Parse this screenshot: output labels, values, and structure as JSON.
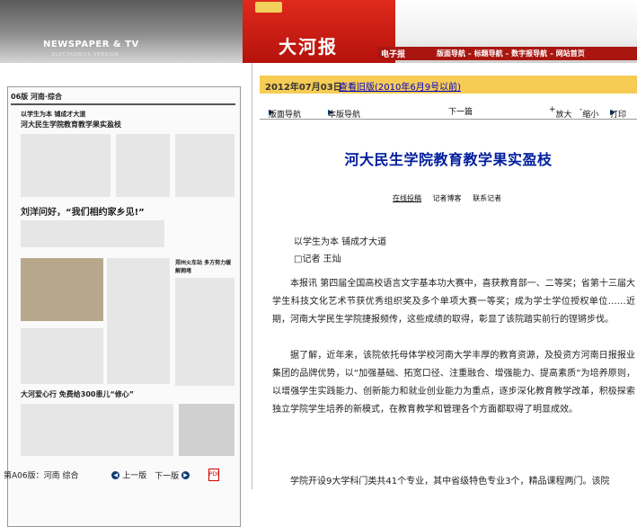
{
  "header": {
    "english_title": "NEWSPAPER & TV",
    "english_subtitle": "ELECTRONICS VERSION",
    "brand": "大河报",
    "epaper_label": "电子报",
    "nav_links": [
      "版面导航",
      "标题导航",
      "数字报导航",
      "网站首页"
    ]
  },
  "left": {
    "page_meta": "06版 河南·综合",
    "headlines": [
      "以学生为本 铺成才大道",
      "河大民生学院教育教学果实盈枝",
      "刘洋问好，“我们相约家乡见!”",
      "大河爱心行 免费给300患儿“修心”",
      "郑州火车站 多方努力缓解拥堵"
    ],
    "bottom": {
      "page_label": "第A06版：河南 综合",
      "prev": "上一版",
      "next": "下一版"
    }
  },
  "right": {
    "date": "2012年07月03日",
    "old_issue_link": "查看旧版(2010年6月9号以前)",
    "nav": {
      "page_nav": "版面导航",
      "page_version_nav": "本版导航",
      "next_article": "下一篇",
      "zoom_in": "放大",
      "zoom_out": "缩小",
      "print": "打印"
    },
    "article": {
      "title": "河大民生学院教育教学果实盈枝",
      "tools": [
        "在线投稿",
        "记者博客",
        "联系记者"
      ],
      "subtitle": "以学生为本 铺成才大道",
      "reporter": "□记者 王灿",
      "paragraphs": [
        "本报讯 第四届全国高校语言文字基本功大赛中，喜获教育部一、二等奖；省第十三届大学生科技文化艺术节获优秀组织奖及多个单项大赛一等奖；成为学士学位授权单位……近期，河南大学民生学院捷报频传，这些成绩的取得，彰显了该院踏实前行的铿锵步伐。",
        "据了解，近年来，该院依托母体学校河南大学丰厚的教育资源，及投资方河南日报报业集团的品牌优势，以“加强基础、拓宽口径、注重融合、增强能力、提高素质”为培养原则，以增强学生实践能力、创新能力和就业创业能力为重点，逐步深化教育教学改革，积极探索独立学院学生培养的新模式，在教育教学和管理各个方面都取得了明显成效。",
        "学院开设9大学科门类共41个专业，其中省级特色专业3个，精品课程两门。该院"
      ]
    }
  },
  "colors": {
    "brand_red": "#c0180f",
    "date_bar": "#f6cc55",
    "title_blue": "#001d9c"
  }
}
